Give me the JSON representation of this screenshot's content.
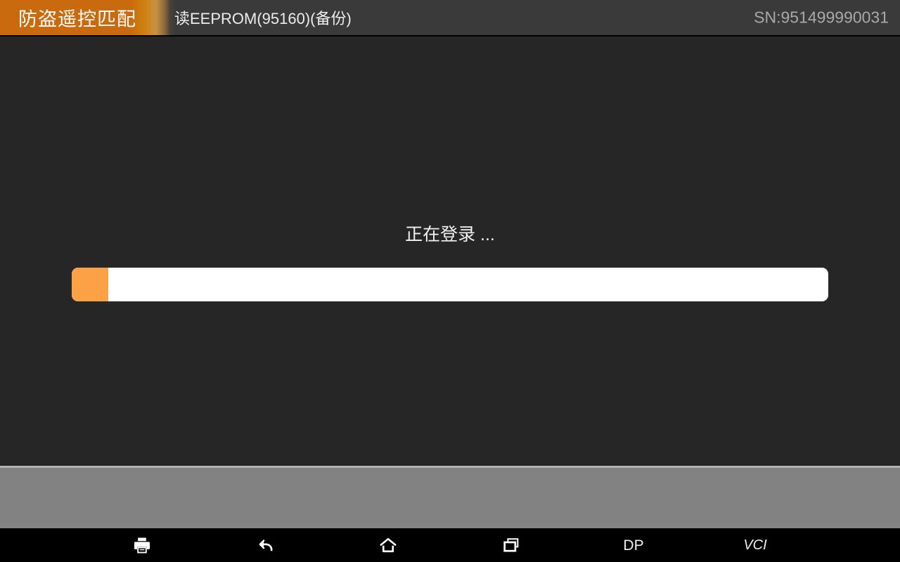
{
  "header": {
    "module_tab_label": "防盗遥控匹配",
    "screen_title": "读EEPROM(95160)(备份)",
    "serial_label": "SN:951499990031",
    "tab_color": "#c96a0e",
    "bar_color": "#3a3a3a",
    "serial_text_color": "#a8a8a8"
  },
  "main": {
    "status_text": "正在登录 ...",
    "progress": {
      "percent": 4.8,
      "fill_color": "#fca146",
      "track_color": "#ffffff"
    },
    "background_color": "#262626"
  },
  "panel": {
    "background_color": "#828282",
    "divider_color": "#b3b3b3"
  },
  "navbar": {
    "background_color": "#000000",
    "items": [
      {
        "name": "print",
        "icon": "printer-icon",
        "label": ""
      },
      {
        "name": "back",
        "icon": "back-arrow-icon",
        "label": ""
      },
      {
        "name": "home",
        "icon": "home-icon",
        "label": ""
      },
      {
        "name": "recents",
        "icon": "recents-icon",
        "label": ""
      },
      {
        "name": "dp",
        "icon": "dp-text-icon",
        "label": "DP"
      },
      {
        "name": "vci",
        "icon": "vci-text-icon",
        "label": "VCI"
      }
    ]
  }
}
